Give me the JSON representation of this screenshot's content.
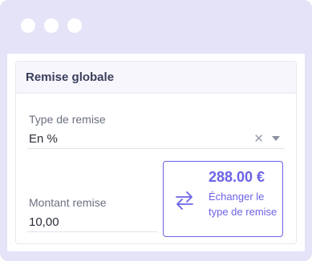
{
  "window": {
    "controls": [
      "dot",
      "dot",
      "dot"
    ]
  },
  "card": {
    "title": "Remise globale"
  },
  "discount_type": {
    "label": "Type de remise",
    "selected": "En %",
    "clear_icon": "close-icon",
    "dropdown_icon": "caret-down-icon"
  },
  "discount_amount": {
    "label": "Montant remise",
    "value": "10,00"
  },
  "swap": {
    "amount": "288.00 €",
    "label": "Échanger le type de remise",
    "icon": "swap-arrows-icon"
  },
  "colors": {
    "accent": "#6c63e6",
    "window_frame": "#e4e3f7",
    "header_bg": "#f6f6fc",
    "title_text": "#3b3f5c",
    "label_text": "#6b7080"
  }
}
